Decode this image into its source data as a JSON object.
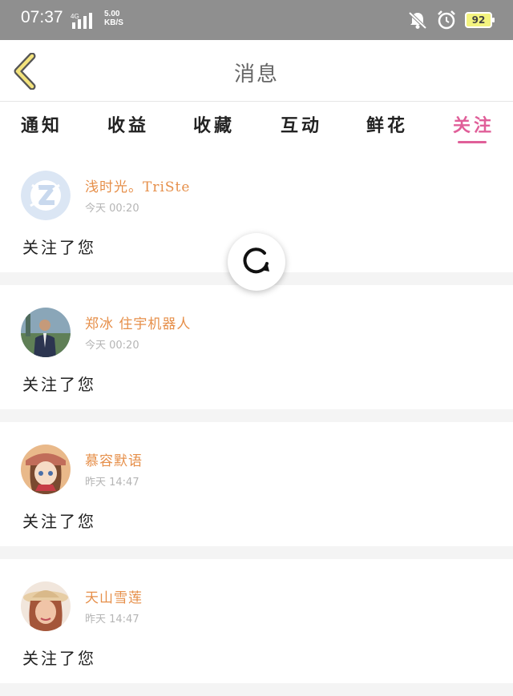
{
  "status": {
    "time": "07:37",
    "network": "4G",
    "speed_value": "5.00",
    "speed_unit": "KB/S",
    "battery": "92"
  },
  "header": {
    "back_icon": "back-chevron-icon",
    "title": "消息"
  },
  "tabs": [
    {
      "label": "通知"
    },
    {
      "label": "收益"
    },
    {
      "label": "收藏"
    },
    {
      "label": "互动"
    },
    {
      "label": "鲜花"
    },
    {
      "label": "关注",
      "active": true
    }
  ],
  "items": [
    {
      "name": "浅时光。TriSte",
      "time": "今天 00:20",
      "message": "关注了您"
    },
    {
      "name": "郑冰 住宇机器人",
      "time": "今天 00:20",
      "message": "关注了您"
    },
    {
      "name": "慕容默语",
      "time": "昨天 14:47",
      "message": "关注了您"
    },
    {
      "name": "天山雪莲",
      "time": "昨天 14:47",
      "message": "关注了您"
    }
  ],
  "refresh_icon": "refresh-icon",
  "colors": {
    "accent": "#e05f99",
    "name": "#e68f4a",
    "status_bar": "#8f8f8f"
  }
}
